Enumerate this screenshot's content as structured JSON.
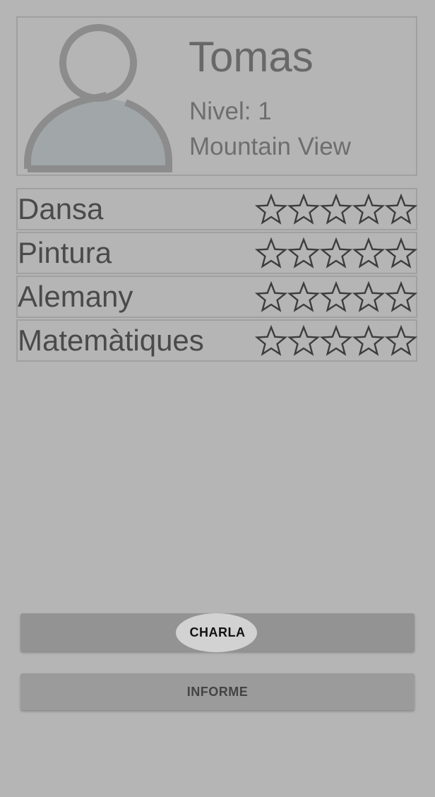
{
  "profile": {
    "name": "Tomas",
    "level": "Nivel: 1",
    "city": "Mountain View",
    "avatar_icon": "person-icon"
  },
  "skills": [
    {
      "label": "Dansa",
      "rating": 0,
      "max_rating": 5
    },
    {
      "label": "Pintura",
      "rating": 0,
      "max_rating": 5
    },
    {
      "label": "Alemany",
      "rating": 0,
      "max_rating": 5
    },
    {
      "label": "Matemàtiques",
      "rating": 0,
      "max_rating": 5
    }
  ],
  "actions": {
    "chat_label": "CHARLA",
    "report_label": "INFORME"
  },
  "colors": {
    "background": "#b5b5b5",
    "button_primary": "#929392",
    "button_secondary": "#9b9b9b",
    "star_outline": "#3d3d3d"
  }
}
